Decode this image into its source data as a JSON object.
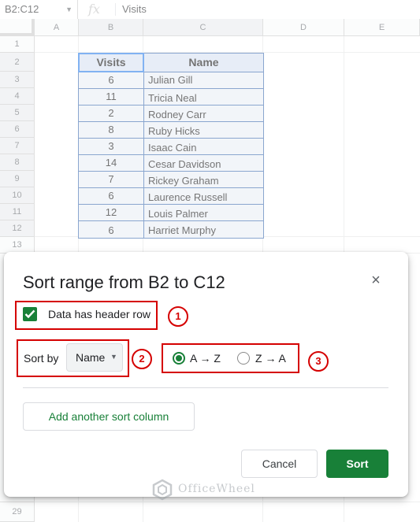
{
  "formula_bar": {
    "name_box": "B2:C12",
    "fx_symbol": "fx",
    "formula": "Visits"
  },
  "columns": [
    "A",
    "B",
    "C",
    "D",
    "E"
  ],
  "rows": [
    "1",
    "2",
    "3",
    "4",
    "5",
    "6",
    "7",
    "8",
    "9",
    "10",
    "11",
    "12",
    "13",
    "29"
  ],
  "table": {
    "header": [
      "Visits",
      "Name"
    ],
    "rows": [
      [
        "6",
        "Julian Gill"
      ],
      [
        "11",
        "Tricia Neal"
      ],
      [
        "2",
        "Rodney Carr"
      ],
      [
        "8",
        "Ruby Hicks"
      ],
      [
        "3",
        "Isaac Cain"
      ],
      [
        "14",
        "Cesar Davidson"
      ],
      [
        "7",
        "Rickey Graham"
      ],
      [
        "6",
        "Laurence Russell"
      ],
      [
        "12",
        "Louis Palmer"
      ],
      [
        "6",
        "Harriet Murphy"
      ]
    ]
  },
  "dialog": {
    "title": "Sort range from B2 to C12",
    "close_symbol": "×",
    "header_row_label": "Data has header row",
    "header_row_checked": true,
    "sort_by_label": "Sort by",
    "sort_by_value": "Name",
    "order_az": "A → Z",
    "order_za": "Z → A",
    "order_selected": "A → Z",
    "add_column_label": "Add another sort column",
    "cancel_label": "Cancel",
    "sort_label": "Sort"
  },
  "annotations": [
    "1",
    "2",
    "3"
  ],
  "watermark": "OfficeWheel",
  "colors": {
    "accent_green": "#188038",
    "annotation_red": "#d50000",
    "selection_blue": "#1a73e8"
  }
}
